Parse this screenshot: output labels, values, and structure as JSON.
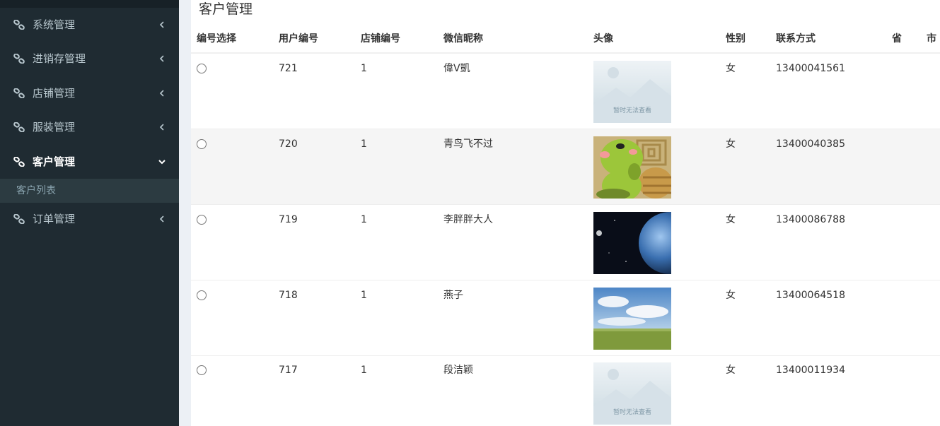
{
  "sidebar": {
    "items": [
      {
        "label": "系统管理",
        "expanded": false
      },
      {
        "label": "进销存管理",
        "expanded": false
      },
      {
        "label": "店铺管理",
        "expanded": false
      },
      {
        "label": "服装管理",
        "expanded": false
      },
      {
        "label": "客户管理",
        "expanded": true
      },
      {
        "label": "订单管理",
        "expanded": false
      }
    ],
    "subitems": [
      {
        "label": "客户列表"
      }
    ],
    "colors": {
      "bg": "#1f2b32",
      "submenu_bg": "#2c3b41",
      "text": "#b8c7ce"
    }
  },
  "main": {
    "title": "客户管理",
    "columns": [
      "编号选择",
      "用户编号",
      "店铺编号",
      "微信昵称",
      "头像",
      "性别",
      "联系方式",
      "省",
      "市"
    ],
    "rows": [
      {
        "user_id": "721",
        "shop_id": "1",
        "nickname": "偉V凱",
        "avatar": "placeholder-image",
        "avatar_text": "暂时无法查看",
        "gender": "女",
        "phone": "13400041561",
        "province": "",
        "city": ""
      },
      {
        "user_id": "720",
        "shop_id": "1",
        "nickname": "青鸟飞不过",
        "avatar": "cartoon-pig-image",
        "gender": "女",
        "phone": "13400040385",
        "province": "",
        "city": ""
      },
      {
        "user_id": "719",
        "shop_id": "1",
        "nickname": "李胖胖大人",
        "avatar": "earth-space-image",
        "gender": "女",
        "phone": "13400086788",
        "province": "",
        "city": ""
      },
      {
        "user_id": "718",
        "shop_id": "1",
        "nickname": "燕子",
        "avatar": "sky-grassland-image",
        "gender": "女",
        "phone": "13400064518",
        "province": "",
        "city": ""
      },
      {
        "user_id": "717",
        "shop_id": "1",
        "nickname": "段洁颖",
        "avatar": "placeholder-image",
        "avatar_text": "暂时无法查看",
        "gender": "女",
        "phone": "13400011934",
        "province": "",
        "city": ""
      }
    ]
  }
}
